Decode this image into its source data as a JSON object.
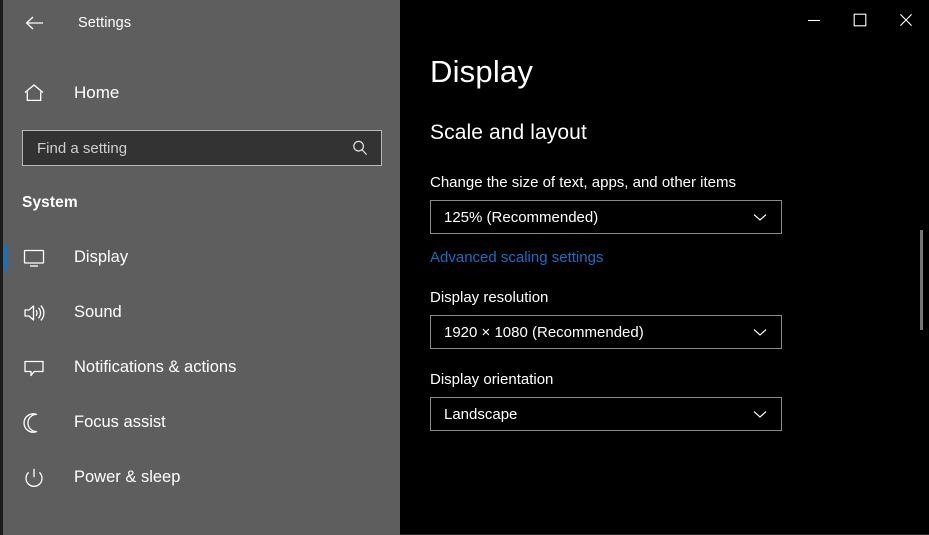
{
  "window": {
    "back_label": "Back",
    "app_title": "Settings",
    "controls": [
      {
        "name": "minimize",
        "label": "Minimize"
      },
      {
        "name": "maximize",
        "label": "Maximize"
      },
      {
        "name": "close",
        "label": "Close"
      }
    ]
  },
  "sidebar": {
    "home_label": "Home",
    "home_icon": "home-icon",
    "search": {
      "placeholder": "Find a setting",
      "value": "",
      "icon": "search-icon"
    },
    "group_header": "System",
    "items": [
      {
        "label": "Display",
        "icon": "monitor-icon",
        "selected": true
      },
      {
        "label": "Sound",
        "icon": "speaker-icon",
        "selected": false
      },
      {
        "label": "Notifications & actions",
        "icon": "speech-bubble-icon",
        "selected": false
      },
      {
        "label": "Focus assist",
        "icon": "moon-icon",
        "selected": false
      },
      {
        "label": "Power & sleep",
        "icon": "power-icon",
        "selected": false
      }
    ]
  },
  "main": {
    "page_title": "Display",
    "section_title": "Scale and layout",
    "scale": {
      "label": "Change the size of text, apps, and other items",
      "value": "125% (Recommended)"
    },
    "advanced_link": "Advanced scaling settings",
    "resolution": {
      "label": "Display resolution",
      "value": "1920 × 1080 (Recommended)"
    },
    "orientation": {
      "label": "Display orientation",
      "value": "Landscape"
    }
  },
  "colors": {
    "accent": "#0078d7",
    "link": "#1a6dc4",
    "sidebar_bg": "#5e5e5e",
    "main_bg": "#000000"
  }
}
